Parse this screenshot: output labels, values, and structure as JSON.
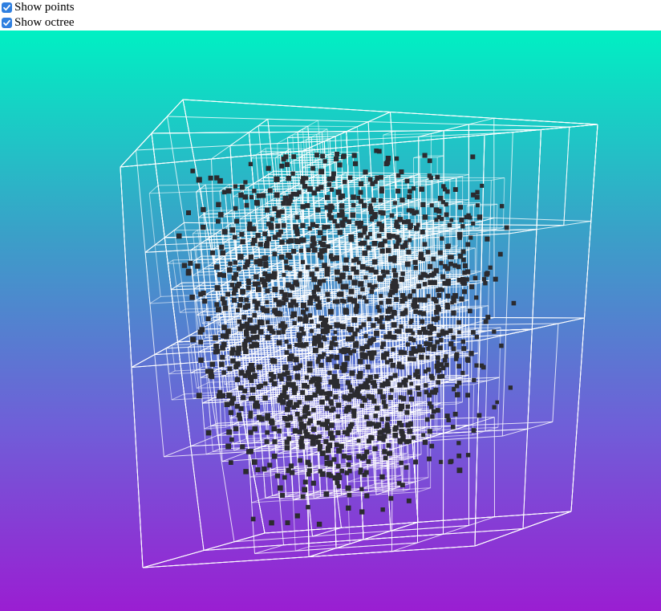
{
  "controls": {
    "show_points": {
      "label": "Show points",
      "checked": true
    },
    "show_octree": {
      "label": "Show octree",
      "checked": true
    }
  },
  "scene": {
    "background_gradient": [
      "#00f0c3",
      "#3aa0c8",
      "#6f5fd8",
      "#9a1ed2"
    ],
    "octree_line_color": "#ffffff",
    "point_color": "#2b2b2f",
    "checkbox_color": "#2f7fe0"
  }
}
